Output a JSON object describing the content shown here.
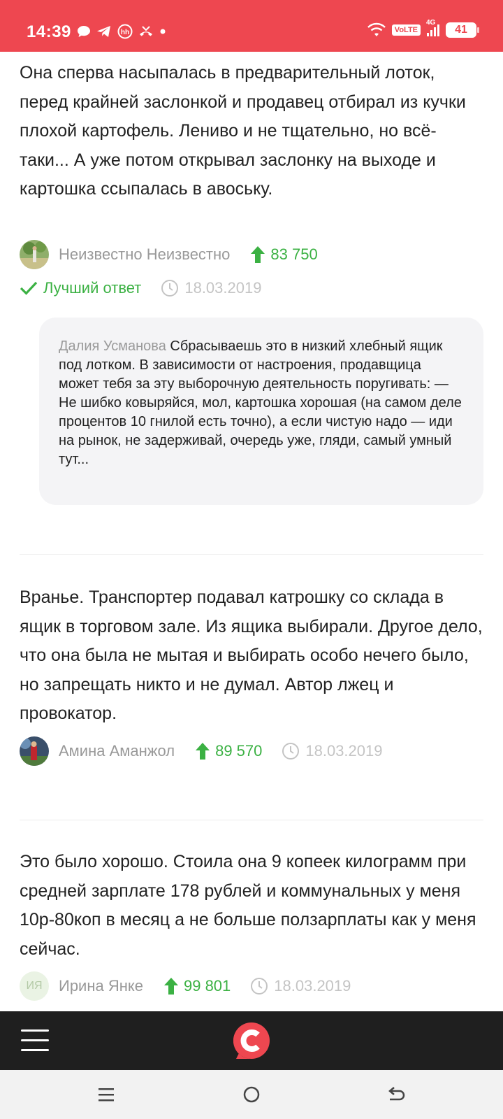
{
  "status_bar": {
    "time": "14:39",
    "volte": "VoLTE",
    "network": "4G",
    "battery": "41",
    "left_icons": [
      "chat-bubble-icon",
      "telegram-icon",
      "hh-icon",
      "missed-call-icon",
      "dot-icon"
    ],
    "right_icons": [
      "wifi-icon",
      "volte-icon",
      "signal-icon",
      "battery-icon"
    ],
    "bg_color": "#ee4750"
  },
  "answers": [
    {
      "text": "Она сперва насыпалась в предварительный лоток, перед крайней заслонкой и продавец отбирал из кучки плохой картофель. Лениво и не тщательно, но всё-таки... А уже потом открывал заслонку на выходе и картошка ссыпалась в авоську.",
      "author": "Неизвестно Неизвестно",
      "score": "83 750",
      "best_label": "Лучший ответ",
      "date": "18.03.2019",
      "comment": {
        "author": "Далия Усманова",
        "text": "Сбрасываешь это в низкий хлебный ящик под лотком. В зависимости от настроения, продавщица может тебя за эту выборочную деятельность поругивать: — Не шибко ковыряйся, мол, картошка хорошая (на самом деле процентов 10 гнилой есть точно), а если чистую надо — иди на рынок, не задерживай, очередь уже, гляди, самый умный тут..."
      }
    },
    {
      "text": "Вранье. Транспортер подавал катрошку со склада в ящик в торговом зале. Из ящика выбирали. Другое дело, что она была не мытая и выбирать особо нечего было, но запрещать никто и не думал. Автор лжец и провокатор.",
      "author": "Амина Аманжол",
      "score": "89 570",
      "date": "18.03.2019"
    },
    {
      "text": "Это было хорошо. Стоила она 9 копеек килограмм при средней зарплате 178 рублей и коммунальных у меня 10р-80коп в месяц а не больше ползарплаты как у меня сейчас.",
      "author": "Ирина Янке",
      "avatar_initials": "ИЯ",
      "score": "99 801",
      "date": "18.03.2019"
    }
  ],
  "colors": {
    "accent_green": "#3bb143",
    "brand_red": "#ee4750",
    "muted_text": "#999999"
  },
  "app_bar": {
    "menu_icon": "hamburger-icon",
    "logo_icon": "site-logo-icon"
  },
  "system_nav": [
    "recents-icon",
    "home-icon",
    "back-icon"
  ]
}
